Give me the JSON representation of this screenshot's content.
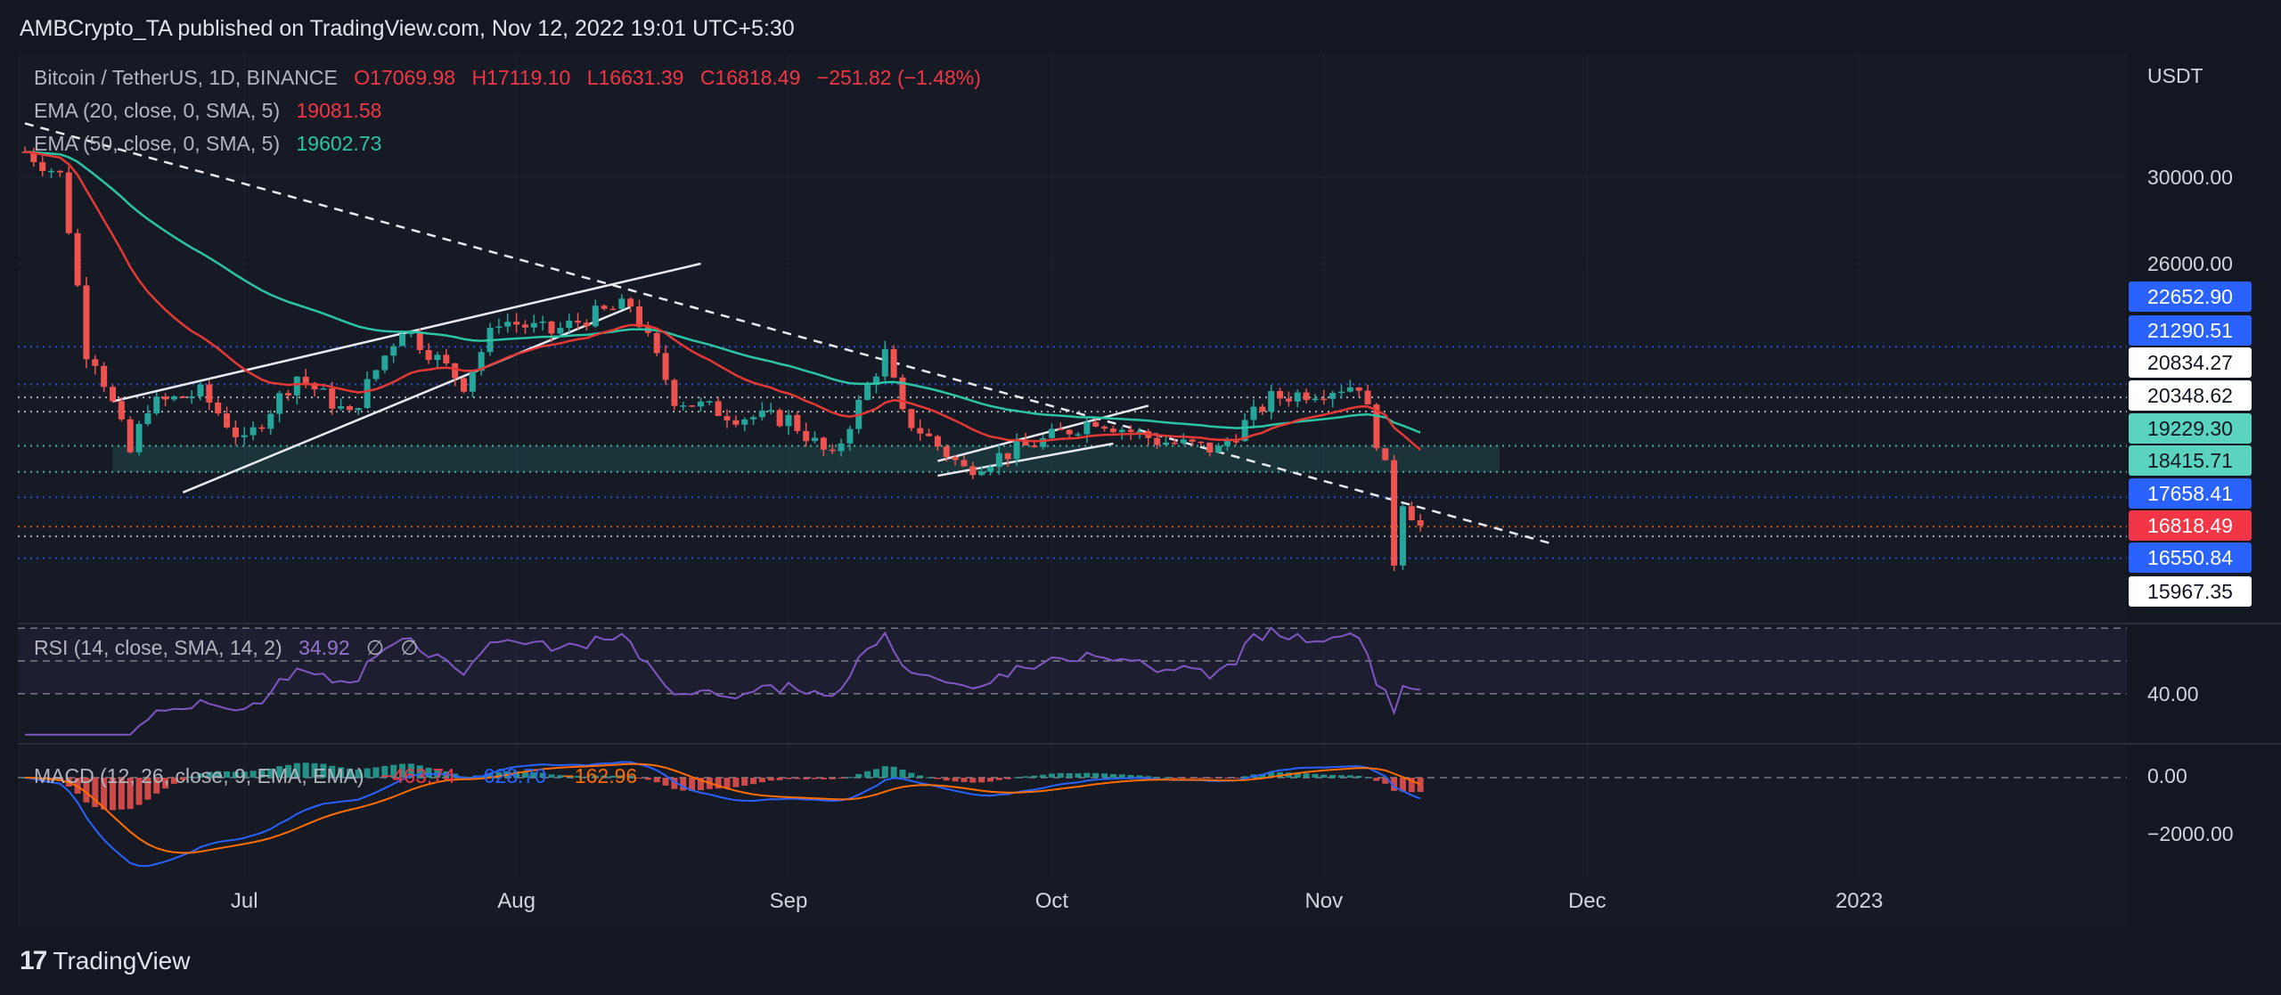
{
  "header": {
    "publisher_line": "AMBCrypto_TA published on TradingView.com, Nov 12, 2022 19:01 UTC+5:30"
  },
  "axis_unit": "USDT",
  "legend": {
    "symbol": "Bitcoin / TetherUS, 1D, BINANCE",
    "open": "O17069.98",
    "high": "H17119.10",
    "low": "L16631.39",
    "close": "C16818.49",
    "change": "−251.82 (−1.48%)",
    "ema20_label": "EMA (20, close, 0, SMA, 5)",
    "ema20_value": "19081.58",
    "ema50_label": "EMA (50, close, 0, SMA, 5)",
    "ema50_value": "19602.73",
    "rsi_label": "RSI (14, close, SMA, 14, 2)",
    "rsi_value": "34.92",
    "rsi_extra1": "∅",
    "rsi_extra2": "∅",
    "macd_label": "MACD (12, 26, close, 9, EMA, EMA)",
    "macd_hist": "−463.74",
    "macd_line": "−628.70",
    "macd_signal": "−162.96"
  },
  "colors": {
    "background": "#131722",
    "up": "#26a69a",
    "down": "#ef5350",
    "ema20": "#e53935",
    "ema50": "#2bc4a5",
    "rsi": "#7e57c2",
    "macd_line": "#2962ff",
    "macd_signal": "#ff6d00",
    "axis_badge_blue": "#2962ff",
    "axis_badge_teal": "#5ad3c0",
    "axis_badge_red": "#f23645"
  },
  "price_axis": {
    "labels": [
      "30000.00",
      "26000.00"
    ],
    "badges": [
      {
        "text": "22652.90",
        "style": "blue"
      },
      {
        "text": "21290.51",
        "style": "blue"
      },
      {
        "text": "20834.27",
        "style": "white"
      },
      {
        "text": "20348.62",
        "style": "white"
      },
      {
        "text": "19229.30",
        "style": "teal"
      },
      {
        "text": "18415.71",
        "style": "teal"
      },
      {
        "text": "17658.41",
        "style": "blue"
      },
      {
        "text": "16818.49",
        "style": "red"
      },
      {
        "text": "16550.84",
        "style": "blue"
      },
      {
        "text": "15967.35",
        "style": "white"
      }
    ]
  },
  "rsi_axis": {
    "labels": [
      "40.00"
    ]
  },
  "macd_axis": {
    "labels": [
      "0.00",
      "−2000.00"
    ]
  },
  "time_axis": {
    "labels": [
      "Jul",
      "Aug",
      "Sep",
      "Oct",
      "Nov",
      "Dec",
      "2023"
    ]
  },
  "footer": {
    "brand": "TradingView",
    "logo": "17"
  },
  "chart_data": {
    "type": "candlestick",
    "symbol": "Bitcoin / TetherUS",
    "interval": "1D",
    "exchange": "BINANCE",
    "y_scale": "log",
    "ylim": [
      15000,
      33000
    ],
    "date_range": [
      "2022-06-06",
      "2022-11-12"
    ],
    "close_series_approx": [
      {
        "date": "2022-06-06",
        "close": 31300
      },
      {
        "date": "2022-06-10",
        "close": 30100
      },
      {
        "date": "2022-06-13",
        "close": 22500
      },
      {
        "date": "2022-06-14",
        "close": 22200
      },
      {
        "date": "2022-06-18",
        "close": 19000
      },
      {
        "date": "2022-06-20",
        "close": 20550
      },
      {
        "date": "2022-06-26",
        "close": 21000
      },
      {
        "date": "2022-07-01",
        "close": 19300
      },
      {
        "date": "2022-07-07",
        "close": 21600
      },
      {
        "date": "2022-07-13",
        "close": 20200
      },
      {
        "date": "2022-07-19",
        "close": 23400
      },
      {
        "date": "2022-07-26",
        "close": 21300
      },
      {
        "date": "2022-07-30",
        "close": 23700
      },
      {
        "date": "2022-08-05",
        "close": 23200
      },
      {
        "date": "2022-08-10",
        "close": 23900
      },
      {
        "date": "2022-08-14",
        "close": 24300
      },
      {
        "date": "2022-08-19",
        "close": 20800
      },
      {
        "date": "2022-08-26",
        "close": 20200
      },
      {
        "date": "2022-09-01",
        "close": 20100
      },
      {
        "date": "2022-09-06",
        "close": 18800
      },
      {
        "date": "2022-09-12",
        "close": 22400
      },
      {
        "date": "2022-09-14",
        "close": 20200
      },
      {
        "date": "2022-09-21",
        "close": 18500
      },
      {
        "date": "2022-09-30",
        "close": 19400
      },
      {
        "date": "2022-10-06",
        "close": 20100
      },
      {
        "date": "2022-10-13",
        "close": 19400
      },
      {
        "date": "2022-10-20",
        "close": 19100
      },
      {
        "date": "2022-10-26",
        "close": 20800
      },
      {
        "date": "2022-11-05",
        "close": 21300
      },
      {
        "date": "2022-11-08",
        "close": 18500
      },
      {
        "date": "2022-11-09",
        "close": 15900
      },
      {
        "date": "2022-11-10",
        "close": 17600
      },
      {
        "date": "2022-11-12",
        "close": 16818.49
      }
    ],
    "last_candle": {
      "open": 17069.98,
      "high": 17119.1,
      "low": 16631.39,
      "close": 16818.49,
      "change": -251.82,
      "change_pct": -1.48
    },
    "ema20_last": 19081.58,
    "ema50_last": 19602.73,
    "horizontal_levels": [
      22652.9,
      21290.51,
      20834.27,
      20348.62,
      19229.3,
      18415.71,
      17658.41,
      16818.49,
      16550.84,
      15967.35
    ],
    "support_zone": [
      18415.71,
      19229.3
    ],
    "rsi_last": 34.92,
    "macd": {
      "histogram": -463.74,
      "macd": -628.7,
      "signal": -162.96
    }
  }
}
